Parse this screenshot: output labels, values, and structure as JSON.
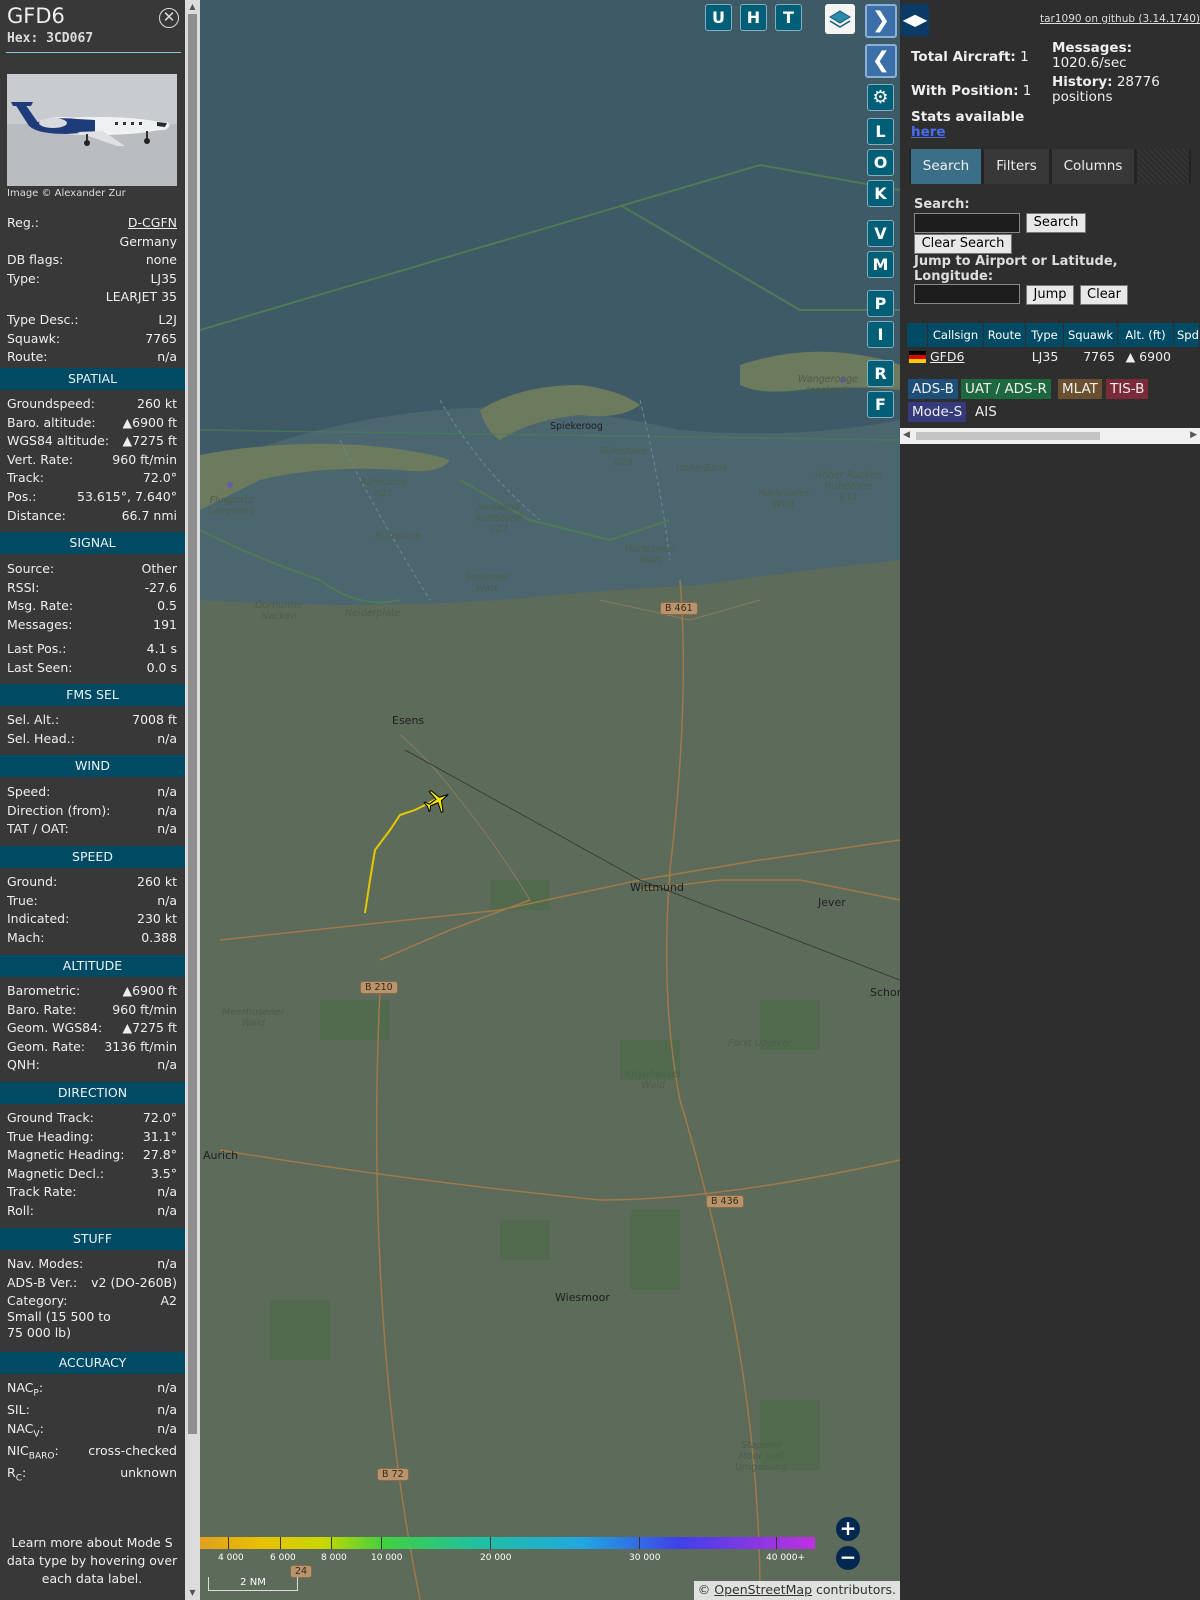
{
  "info": {
    "callsign": "GFD6",
    "hex_label": "Hex:",
    "hex": "3CD067",
    "photo_credit": "Image © Alexander Zur",
    "details": [
      {
        "k": "Reg.:",
        "v": "D-CGFN",
        "link": true
      },
      {
        "k": "",
        "v": "Germany"
      },
      {
        "k": "DB flags:",
        "v": "none"
      },
      {
        "k": "Type:",
        "v": "LJ35"
      },
      {
        "k": "",
        "v": "LEARJET 35"
      },
      {
        "k": "Type Desc.:",
        "v": "L2J"
      },
      {
        "k": "Squawk:",
        "v": "7765"
      },
      {
        "k": "Route:",
        "v": "n/a"
      }
    ],
    "sections": [
      {
        "title": "SPATIAL",
        "rows": [
          {
            "k": "Groundspeed:",
            "v": "260 kt"
          },
          {
            "k": "Baro. altitude:",
            "v": "▲6900 ft"
          },
          {
            "k": "WGS84 altitude:",
            "v": "▲7275 ft"
          },
          {
            "k": "Vert. Rate:",
            "v": "960 ft/min"
          },
          {
            "k": "Track:",
            "v": "72.0°"
          },
          {
            "k": "Pos.:",
            "v": "53.615°, 7.640°"
          },
          {
            "k": "Distance:",
            "v": "66.7 nmi"
          }
        ]
      },
      {
        "title": "SIGNAL",
        "rows": [
          {
            "k": "Source:",
            "v": "Other"
          },
          {
            "k": "RSSI:",
            "v": "-27.6"
          },
          {
            "k": "Msg. Rate:",
            "v": "0.5"
          },
          {
            "k": "Messages:",
            "v": "191"
          },
          {
            "k": "Last Pos.:",
            "v": "4.1 s"
          },
          {
            "k": "Last Seen:",
            "v": "0.0 s"
          }
        ]
      },
      {
        "title": "FMS SEL",
        "rows": [
          {
            "k": "Sel. Alt.:",
            "v": "7008 ft"
          },
          {
            "k": "Sel. Head.:",
            "v": "n/a"
          }
        ]
      },
      {
        "title": "WIND",
        "rows": [
          {
            "k": "Speed:",
            "v": "n/a"
          },
          {
            "k": "Direction (from):",
            "v": "n/a"
          },
          {
            "k": "TAT / OAT:",
            "v": "n/a"
          }
        ]
      },
      {
        "title": "SPEED",
        "rows": [
          {
            "k": "Ground:",
            "v": "260 kt"
          },
          {
            "k": "True:",
            "v": "n/a"
          },
          {
            "k": "Indicated:",
            "v": "230 kt"
          },
          {
            "k": "Mach:",
            "v": "0.388"
          }
        ]
      },
      {
        "title": "ALTITUDE",
        "rows": [
          {
            "k": "Barometric:",
            "v": "▲6900 ft"
          },
          {
            "k": "Baro. Rate:",
            "v": "960 ft/min"
          },
          {
            "k": "Geom. WGS84:",
            "v": "▲7275 ft"
          },
          {
            "k": "Geom. Rate:",
            "v": "3136 ft/min"
          },
          {
            "k": "QNH:",
            "v": "n/a"
          }
        ]
      },
      {
        "title": "DIRECTION",
        "rows": [
          {
            "k": "Ground Track:",
            "v": "72.0°"
          },
          {
            "k": "True Heading:",
            "v": "31.1°"
          },
          {
            "k": "Magnetic Heading:",
            "v": "27.8°"
          },
          {
            "k": "Magnetic Decl.:",
            "v": "3.5°"
          },
          {
            "k": "Track Rate:",
            "v": "n/a"
          },
          {
            "k": "Roll:",
            "v": "n/a"
          }
        ]
      },
      {
        "title": "STUFF",
        "rows": [
          {
            "k": "Nav. Modes:",
            "v": "n/a"
          },
          {
            "k": "ADS-B Ver.:",
            "v": "v2 (DO-260B)"
          },
          {
            "k": "Category:",
            "v": "A2"
          },
          {
            "k": "Small (15 500 to",
            "v": ""
          },
          {
            "k": "75 000 lb)",
            "v": ""
          }
        ]
      }
    ],
    "accuracy": {
      "title": "ACCURACY",
      "rows": [
        {
          "k": "NAC",
          "sub": "P",
          "v": "n/a"
        },
        {
          "k": "SIL:",
          "sub": "",
          "v": "n/a"
        },
        {
          "k": "NAC",
          "sub": "V",
          "v": "n/a"
        },
        {
          "k": "NIC",
          "sub": "BARO",
          "v": "cross-checked"
        },
        {
          "k": "R",
          "sub": "C",
          "v": "unknown"
        }
      ]
    },
    "learn_more": "Learn more about Mode S data type by hovering over each data label."
  },
  "map": {
    "buttons": {
      "u": "U",
      "h": "H",
      "t": "T",
      "l": "L",
      "o": "O",
      "k": "K",
      "v": "V",
      "m": "M",
      "p": "P",
      "i": "I",
      "r": "R",
      "f": "F"
    },
    "places": {
      "esens": "Esens",
      "wittmund": "Wittmund",
      "jever": "Jever",
      "aurich": "Aurich",
      "wiesmoor": "Wiesmoor",
      "schor": "Schor",
      "spiekeroog": "Spiekeroog"
    },
    "italic_places": {
      "ruhezone_i29": "Ruhezone\nI/29",
      "ruhezone_i25": "Ruhezone\nI/25",
      "ruhezone_i27": "Janssand\nRuhezone\nI/27",
      "ruhezone_i31": "Hoher Rucken\nRuhezone\nI/31",
      "flugplatz": "Flugplatz\nLangeoog",
      "ruteplate": "Ruteplate",
      "hohe_bank": "Hohe Bank",
      "harlesieler_watt": "Harlesieler\nWatt",
      "harlesieler_watt2": "Harlesieler\nWatt",
      "seriemer_watt": "Seriemer\nWatt",
      "dornumer_nacken": "Dornumer\nNacken",
      "neiderplate": "Neiderplate",
      "wangerooge": "Wangerooge\nInselwatt",
      "meerhusener_wald": "Meerhusener\nWald",
      "forst_upjever": "Forst Upjever",
      "knyphauser_wald": "Knyphauser\nWald",
      "stapeler_moor": "Stapeler\nMoor und\nUmgebung"
    },
    "roads": {
      "b461": "B 461",
      "b210": "B 210",
      "b436": "B 436",
      "b72": "B 72",
      "r24": "24"
    },
    "altitude_scale": [
      "4 000",
      "6 000",
      "8 000",
      "10 000",
      "20 000",
      "30 000",
      "40 000+"
    ],
    "scale_bar": "2 NM",
    "attribution_prefix": "© ",
    "attribution_link": "OpenStreetMap",
    "attribution_suffix": " contributors."
  },
  "sidebar": {
    "github": "tar1090 on github (3.14.1740)",
    "total_aircraft_label": "Total Aircraft:",
    "total_aircraft": "1",
    "with_position_label": "With Position:",
    "with_position": "1",
    "stats_label": "Stats available",
    "stats_link": "here",
    "messages_label": "Messages:",
    "messages_value": "1020.6/sec",
    "history_label": "History:",
    "history_value": "28776",
    "history_unit": "positions",
    "tabs": [
      "Search",
      "Filters",
      "Columns"
    ],
    "search_label": "Search:",
    "search_button": "Search",
    "clear_search_button": "Clear Search",
    "jump_label": "Jump to Airport or Latitude, Longitude:",
    "jump_button": "Jump",
    "clear_button": "Clear",
    "table_headers": [
      "Callsign",
      "Route",
      "Type",
      "Squawk",
      "Alt. (ft)",
      "Spd"
    ],
    "table_row": {
      "callsign": "GFD6",
      "route": "",
      "type": "LJ35",
      "squawk": "7765",
      "alt": "▲ 6900"
    },
    "badges": [
      "ADS-B",
      "UAT / ADS-R",
      "MLAT",
      "TIS-B",
      "Mode-S",
      "AIS"
    ]
  },
  "colors": {
    "section_bg": "#004b63",
    "track": "#e6c800",
    "aircraft": "#f2e600"
  }
}
